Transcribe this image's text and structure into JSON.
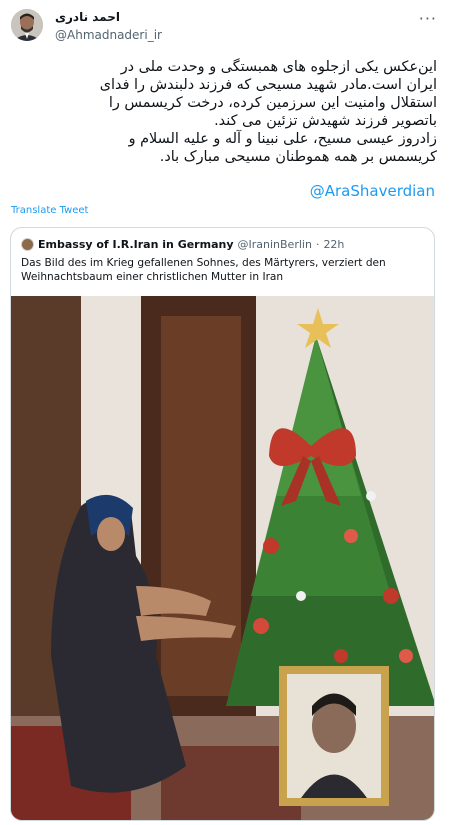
{
  "tweet": {
    "author_name": "احمد نادری",
    "author_handle": "@Ahmadnaderi_ir",
    "more_icon": "more-dots-icon",
    "lines": [
      "این‌عکس یکی ازجلوه های همبستگی و وحدت ملی در",
      "ایران است.مادر شهید مسیحی که فرزند دلبندش را فدای",
      "استقلال وامنیت این سرزمین کرده، درخت کریسمس را",
      "باتصویر فرزند شهیدش تزئین می کند.",
      "زادروز عیسی مسیح، علی نبینا و آله و علیه السلام و",
      "کریسمس بر همه هموطنان مسیحی مبارک باد."
    ],
    "mention": "@AraShaverdian",
    "translate_label": "Translate Tweet"
  },
  "quote": {
    "author_name": "Embassy of I.R.Iran in Germany",
    "author_handle": "@IraninBerlin",
    "separator": "·",
    "time": "22h",
    "text": "Das Bild des im Krieg gefallenen Sohnes, des Märtyrers, verziert den Weihnachtsbaum einer christlichen Mutter in Iran"
  },
  "colors": {
    "link": "#1d9bf0",
    "border": "#cfd9de",
    "muted": "#536471"
  }
}
